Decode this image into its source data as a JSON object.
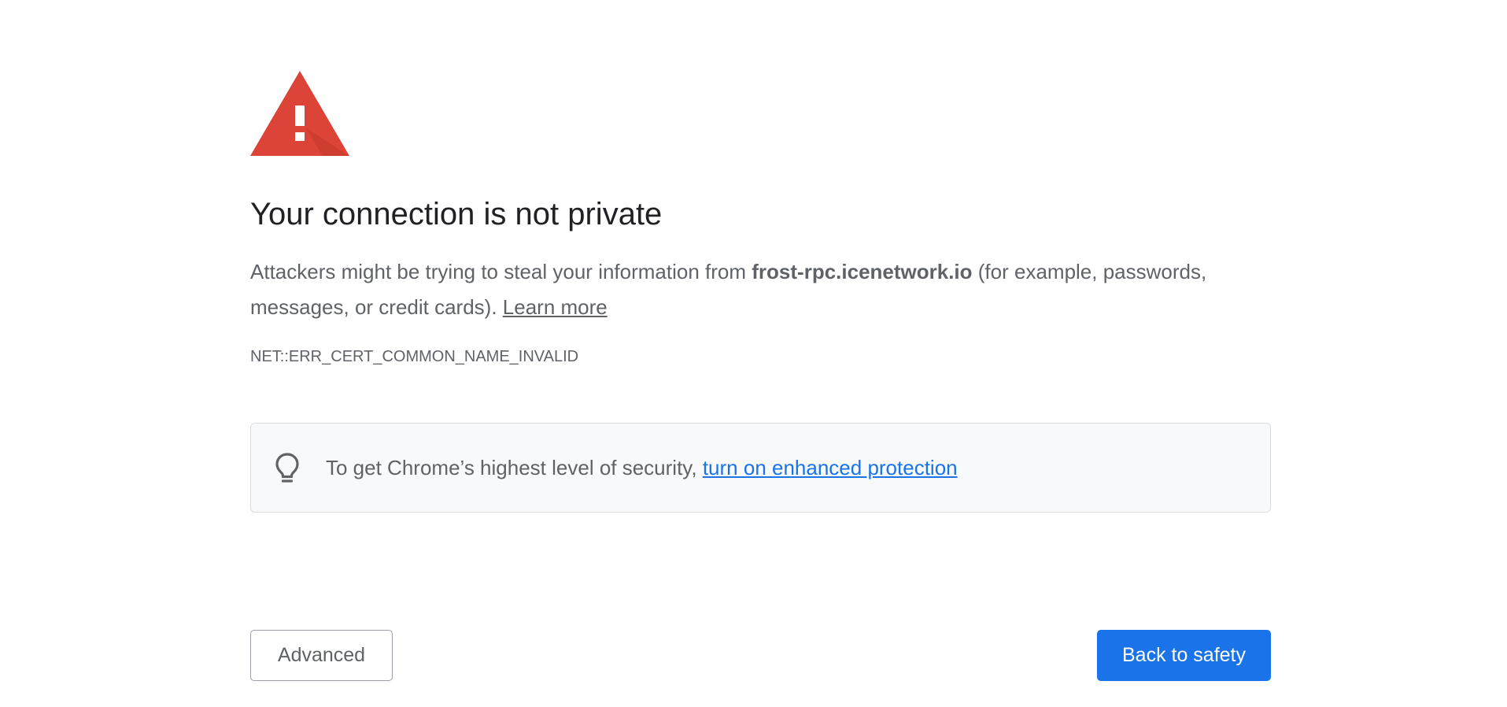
{
  "page": {
    "icon": "warning-triangle-icon",
    "icon_color": "#db4437",
    "title": "Your connection is not private",
    "description": {
      "prefix": "Attackers might be trying to steal your information from ",
      "host": "frost-rpc.icenetwork.io",
      "suffix": " (for example, passwords, messages, or credit cards). ",
      "learn_more": "Learn more"
    },
    "error_code": "NET::ERR_CERT_COMMON_NAME_INVALID"
  },
  "protection": {
    "icon": "lightbulb-icon",
    "text": "To get Chrome’s highest level of security, ",
    "link": "turn on enhanced protection",
    "link_color": "#1a73e8"
  },
  "buttons": {
    "advanced": "Advanced",
    "back": "Back to safety",
    "back_color": "#1a73e8"
  }
}
